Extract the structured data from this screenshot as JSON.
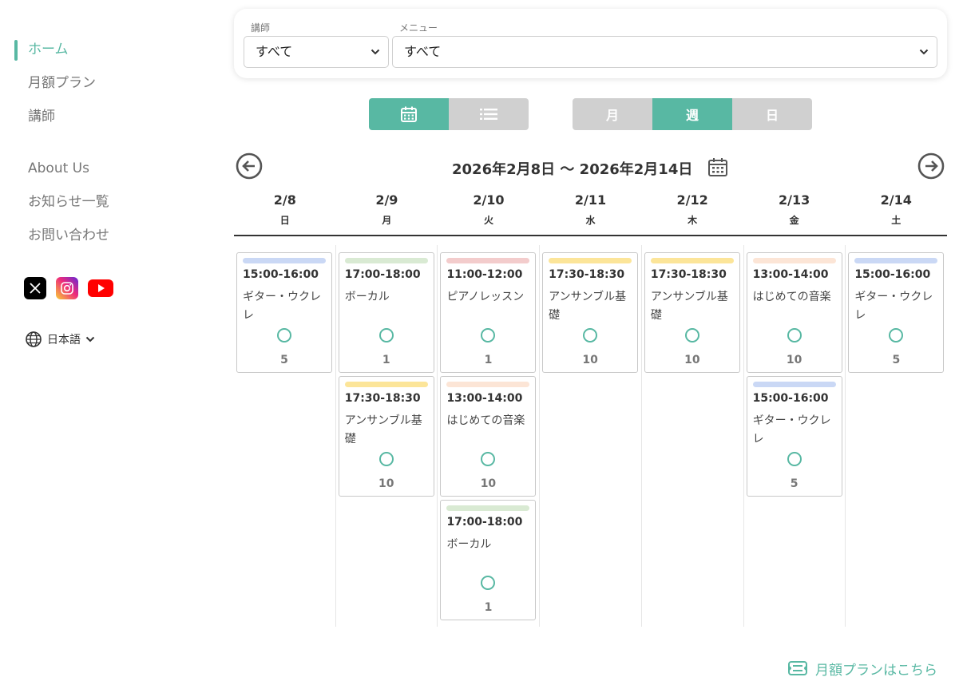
{
  "nav": {
    "items": [
      {
        "label": "ホーム",
        "active": true
      },
      {
        "label": "月額プラン"
      },
      {
        "label": "講師"
      }
    ],
    "items2": [
      {
        "label": "About Us"
      },
      {
        "label": "お知らせ一覧"
      },
      {
        "label": "お問い合わせ"
      }
    ],
    "language": "日本語"
  },
  "filters": {
    "teacher_label": "講師",
    "teacher_value": "すべて",
    "menu_label": "メニュー",
    "menu_value": "すべて"
  },
  "view_toggle": {
    "calendar_icon": "calendar-icon",
    "list_icon": "list-icon",
    "active": "calendar"
  },
  "period_toggle": {
    "month": "月",
    "week": "週",
    "day": "日",
    "active": "week"
  },
  "week": {
    "range": "2026年2月8日 〜 2026年2月14日"
  },
  "days": [
    {
      "date": "2/8",
      "weekday": "日"
    },
    {
      "date": "2/9",
      "weekday": "月"
    },
    {
      "date": "2/10",
      "weekday": "火"
    },
    {
      "date": "2/11",
      "weekday": "水"
    },
    {
      "date": "2/12",
      "weekday": "木"
    },
    {
      "date": "2/13",
      "weekday": "金"
    },
    {
      "date": "2/14",
      "weekday": "土"
    }
  ],
  "colors": {
    "accent": "#58b8a3",
    "guitar": "#cad8f5",
    "vocal": "#d9ead3",
    "piano": "#f3cccc",
    "ensemble": "#fce599",
    "beginner": "#fce5d6"
  },
  "events": [
    [
      {
        "time": "15:00-16:00",
        "title": "ギター・ウクレレ",
        "count": "5",
        "color": "#cad8f5"
      }
    ],
    [
      {
        "time": "17:00-18:00",
        "title": "ボーカル",
        "count": "1",
        "color": "#d9ead3"
      },
      {
        "time": "17:30-18:30",
        "title": "アンサンブル基礎",
        "count": "10",
        "color": "#fce599"
      }
    ],
    [
      {
        "time": "11:00-12:00",
        "title": "ピアノレッスン",
        "count": "1",
        "color": "#f3cccc"
      },
      {
        "time": "13:00-14:00",
        "title": "はじめての音楽",
        "count": "10",
        "color": "#fce5d6"
      },
      {
        "time": "17:00-18:00",
        "title": "ボーカル",
        "count": "1",
        "color": "#d9ead3"
      }
    ],
    [
      {
        "time": "17:30-18:30",
        "title": "アンサンブル基礎",
        "count": "10",
        "color": "#fce599"
      }
    ],
    [
      {
        "time": "17:30-18:30",
        "title": "アンサンブル基礎",
        "count": "10",
        "color": "#fce599"
      }
    ],
    [
      {
        "time": "13:00-14:00",
        "title": "はじめての音楽",
        "count": "10",
        "color": "#fce5d6"
      },
      {
        "time": "15:00-16:00",
        "title": "ギター・ウクレレ",
        "count": "5",
        "color": "#cad8f5"
      }
    ],
    [
      {
        "time": "15:00-16:00",
        "title": "ギター・ウクレレ",
        "count": "5",
        "color": "#cad8f5"
      }
    ]
  ],
  "monthly_link": "月額プランはこちら"
}
